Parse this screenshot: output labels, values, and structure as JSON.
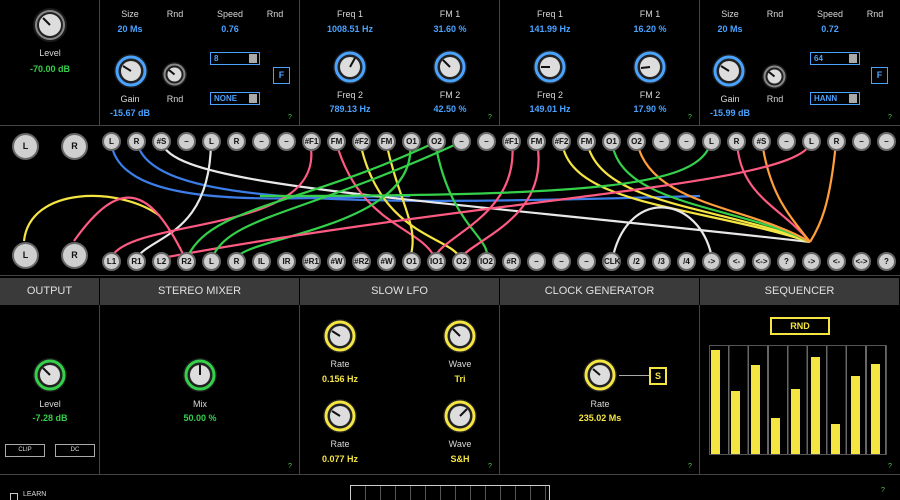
{
  "top": {
    "level": {
      "label": "Level",
      "value": "-70.00 dB"
    },
    "delay1": {
      "size_label": "Size",
      "size_value": "20 Ms",
      "rnd1": "Rnd",
      "speed_label": "Speed",
      "speed_value": "0.76",
      "rnd2": "Rnd",
      "gain_label": "Gain",
      "gain_value": "-15.67 dB",
      "rnd3": "Rnd",
      "select1": "8",
      "select2": "NONE",
      "f": "F"
    },
    "fm1": {
      "freq1_label": "Freq 1",
      "freq1_value": "1008.51 Hz",
      "fm1_label": "FM 1",
      "fm1_value": "31.60 %",
      "freq2_label": "Freq 2",
      "freq2_value": "789.13 Hz",
      "fm2_label": "FM 2",
      "fm2_value": "42.50 %"
    },
    "fm2": {
      "freq1_label": "Freq 1",
      "freq1_value": "141.99 Hz",
      "fm1_label": "FM 1",
      "fm1_value": "16.20 %",
      "freq2_label": "Freq 2",
      "freq2_value": "149.01 Hz",
      "fm2_label": "FM 2",
      "fm2_value": "17.90 %"
    },
    "delay2": {
      "size_label": "Size",
      "size_value": "20 Ms",
      "rnd1": "Rnd",
      "speed_label": "Speed",
      "speed_value": "0.72",
      "rnd2": "Rnd",
      "gain_label": "Gain",
      "gain_value": "-15.99 dB",
      "rnd3": "Rnd",
      "select1": "64",
      "select2": "HANN",
      "f": "F"
    },
    "help": "?"
  },
  "patch": {
    "left_big": [
      "L",
      "R"
    ],
    "top_row": [
      "L",
      "R",
      "#S",
      "–",
      "L",
      "R",
      "–",
      "–",
      "#F1",
      "FM",
      "#F2",
      "FM",
      "O1",
      "O2",
      "–",
      "–",
      "#F1",
      "FM",
      "#F2",
      "FM",
      "O1",
      "O2",
      "–",
      "–",
      "L",
      "R",
      "#S",
      "–",
      "L",
      "R",
      "–",
      "–"
    ],
    "bottom_big": [
      "L",
      "R"
    ],
    "bottom_row": [
      "L1",
      "R1",
      "L2",
      "R2",
      "L",
      "R",
      "IL",
      "IR",
      "#R1",
      "#W",
      "#R2",
      "#W",
      "O1",
      "IO1",
      "O2",
      "IO2",
      "#R",
      "–",
      "–",
      "–",
      "CLK",
      "/2",
      "/3",
      "/4",
      "->",
      "<-",
      "<->",
      "?",
      "->",
      "<-",
      "<->",
      "?"
    ]
  },
  "headers": [
    "OUTPUT",
    "STEREO MIXER",
    "SLOW LFO",
    "CLOCK GENERATOR",
    "SEQUENCER"
  ],
  "output": {
    "label": "Level",
    "value": "-7.28 dB",
    "clip": "CLIP",
    "dc": "DC"
  },
  "mixer": {
    "label": "Mix",
    "value": "50.00 %"
  },
  "lfo": {
    "rate1_label": "Rate",
    "rate1_value": "0.156 Hz",
    "wave1_label": "Wave",
    "wave1_value": "Tri",
    "rate2_label": "Rate",
    "rate2_value": "0.077 Hz",
    "wave2_label": "Wave",
    "wave2_value": "S&H"
  },
  "clock": {
    "label": "Rate",
    "value": "235.02 Ms",
    "s": "S"
  },
  "sequencer": {
    "rnd": "RND",
    "steps": [
      0.96,
      0.58,
      0.82,
      0.33,
      0.6,
      0.9,
      0.28,
      0.72,
      0.83
    ]
  },
  "footer": {
    "learn": "LEARN",
    "help": "?"
  },
  "colors": {
    "accent_blue": "#4aa3ff",
    "green": "#35d04a",
    "yellow": "#f4e542"
  }
}
